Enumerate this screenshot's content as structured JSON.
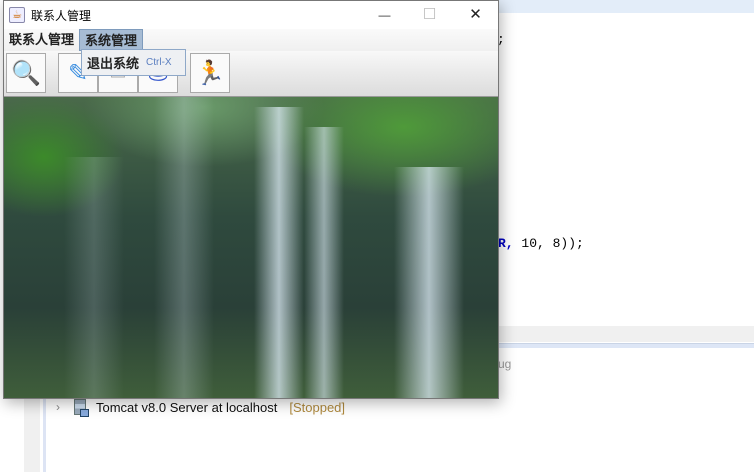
{
  "window": {
    "title": "联系人管理",
    "minimize": "—",
    "maximize": "☐",
    "close": "✕"
  },
  "menubar": {
    "items": [
      "联系人管理",
      "系统管理"
    ]
  },
  "dropdown": {
    "label": "退出系统",
    "shortcut": "Ctrl-X"
  },
  "toolbar": {
    "icons": [
      "search-icon",
      "edit-icon",
      "document-icon",
      "database-icon",
      "running-man-icon"
    ]
  },
  "ide": {
    "code_line1": ";",
    "code_line2": "R, 10, 8));",
    "debug_fragment": "ug",
    "server": {
      "name": "Tomcat v8.0 Server at localhost",
      "status": "[Stopped]"
    }
  }
}
